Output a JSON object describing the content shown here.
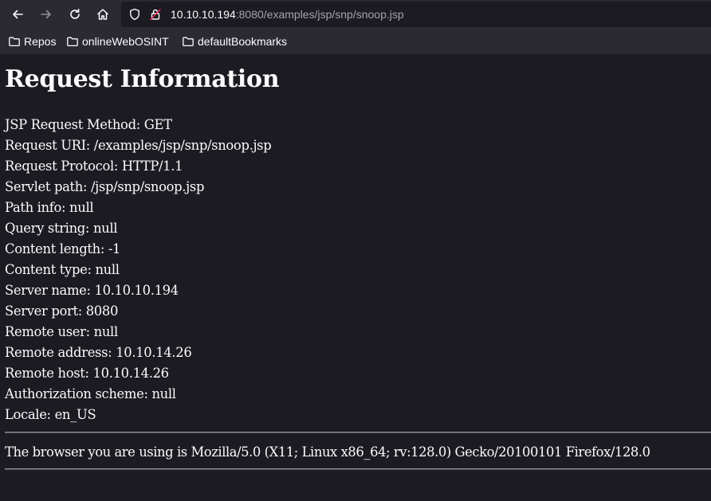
{
  "toolbar": {
    "back_icon": "arrow-left-icon",
    "forward_icon": "arrow-right-icon",
    "reload_icon": "reload-icon",
    "home_icon": "home-icon",
    "url_host": "10.10.10.194",
    "url_rest": ":8080/examples/jsp/snp/snoop.jsp"
  },
  "bookmarks": [
    {
      "label": "Repos",
      "icon": "folder-icon"
    },
    {
      "label": "onlineWebOSINT",
      "icon": "folder-icon"
    },
    {
      "label": "defaultBookmarks",
      "icon": "folder-icon"
    }
  ],
  "page": {
    "title": "Request Information",
    "lines": [
      "JSP Request Method: GET",
      "Request URI: /examples/jsp/snp/snoop.jsp",
      "Request Protocol: HTTP/1.1",
      "Servlet path: /jsp/snp/snoop.jsp",
      "Path info: null",
      "Query string: null",
      "Content length: -1",
      "Content type: null",
      "Server name: 10.10.10.194",
      "Server port: 8080",
      "Remote user: null",
      "Remote address: 10.10.14.26",
      "Remote host: 10.10.14.26",
      "Authorization scheme: null",
      "Locale: en_US"
    ],
    "user_agent_line": "The browser you are using is Mozilla/5.0 (X11; Linux x86_64; rv:128.0) Gecko/20100101 Firefox/128.0"
  },
  "colors": {
    "chrome_bg": "#2b2a33",
    "page_bg": "#1c1b22",
    "text": "#fbfbfe",
    "muted_text": "#a5a4ab",
    "lock_warning": "#e22850"
  }
}
